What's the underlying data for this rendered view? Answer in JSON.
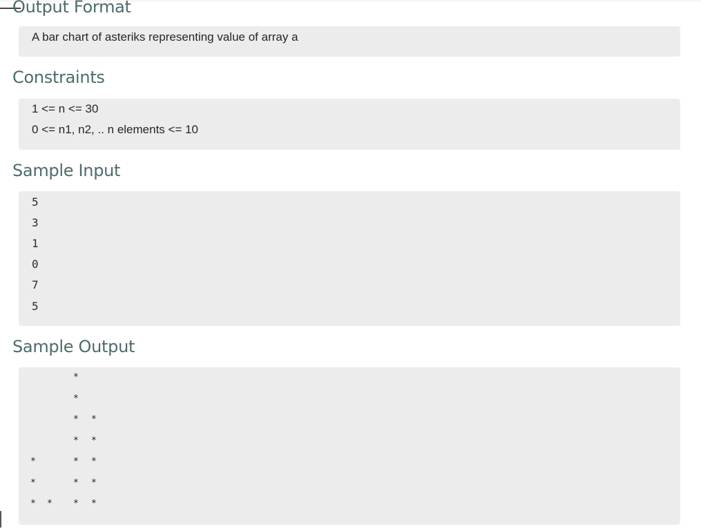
{
  "output_format": {
    "heading": "Output Format",
    "text": "A bar chart of asteriks representing value of array a"
  },
  "constraints": {
    "heading": "Constraints",
    "lines": [
      "1 <= n <= 30",
      "0 <= n1, n2, .. n elements <= 10"
    ]
  },
  "sample_input": {
    "heading": "Sample Input",
    "lines": [
      "5",
      "3",
      "1",
      "0",
      "7",
      "5"
    ]
  },
  "sample_output": {
    "heading": "Sample Output",
    "values": [
      3,
      1,
      0,
      7,
      5
    ],
    "symbol": "*"
  }
}
